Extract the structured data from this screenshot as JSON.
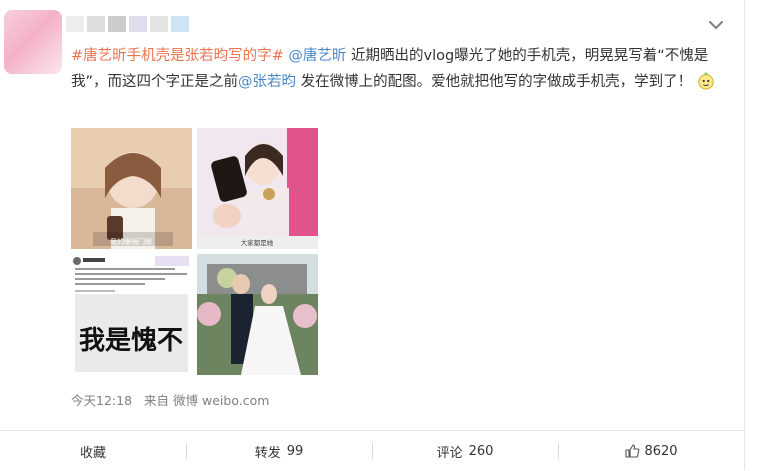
{
  "post": {
    "hashtag": "#唐艺昕手机壳是张若昀写的字#",
    "mention1": "@唐艺昕",
    "text1": " 近期晒出的vlog曝光了她的手机壳，明晃晃写着“不愧是我”，而这四个字正是之前",
    "mention2": "@张若昀",
    "text2": " 发在微博上的配图。爱他就把他写的字做成手机壳，学到了！",
    "emoji": "bulb-face-emoji"
  },
  "images": [
    {
      "caption": "我的眼镜门牌"
    },
    {
      "caption": "大家都是她"
    },
    {
      "caption": "我是愧不"
    },
    {
      "caption": ""
    }
  ],
  "meta": {
    "time": "今天12:18",
    "source_prefix": "来自",
    "source": "微博 weibo.com"
  },
  "actions": {
    "favorite": "收藏",
    "repost": "转发",
    "repost_count": "99",
    "comment": "评论",
    "comment_count": "260",
    "like_count": "8620"
  },
  "colors": {
    "hashtag": "#eb7350",
    "mention": "#4a86c6",
    "text": "#333333",
    "meta": "#808080"
  }
}
